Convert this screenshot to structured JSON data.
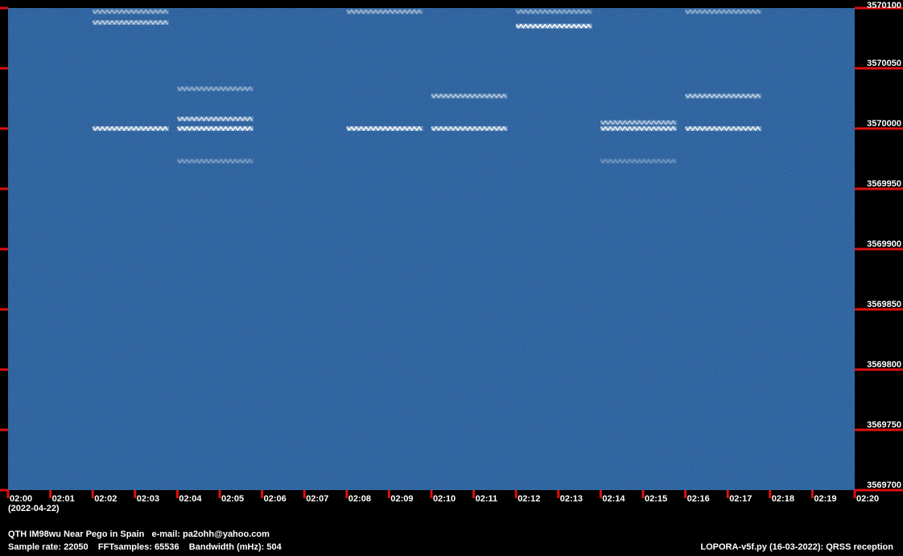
{
  "chart_data": {
    "type": "heatmap",
    "subtype": "spectrogram-waterfall",
    "x_axis": {
      "ticks": [
        "02:00",
        "02:01",
        "02:02",
        "02:03",
        "02:04",
        "02:05",
        "02:06",
        "02:07",
        "02:08",
        "02:09",
        "02:10",
        "02:11",
        "02:12",
        "02:13",
        "02:14",
        "02:15",
        "02:16",
        "02:17",
        "02:18",
        "02:19",
        "02:20"
      ],
      "range_minutes": [
        0,
        20
      ],
      "date_label": "(2022-04-22)"
    },
    "y_axis": {
      "ticks": [
        "3570100",
        "3570050",
        "3570000",
        "3569950",
        "3569900",
        "3569850",
        "3569800",
        "3569750",
        "3569700"
      ],
      "range": [
        3569700,
        3570100
      ],
      "position": "right"
    },
    "colors": {
      "background": "#1d4e91",
      "signal": "#ffffff",
      "tick": "#e01010"
    },
    "signals": [
      {
        "freq": 3570000,
        "start_min": 2.0,
        "end_min": 3.8,
        "intensity": 0.9
      },
      {
        "freq": 3570000,
        "start_min": 4.0,
        "end_min": 5.8,
        "intensity": 0.95
      },
      {
        "freq": 3570000,
        "start_min": 8.0,
        "end_min": 9.8,
        "intensity": 0.95
      },
      {
        "freq": 3570000,
        "start_min": 10.0,
        "end_min": 11.8,
        "intensity": 0.85
      },
      {
        "freq": 3570000,
        "start_min": 14.0,
        "end_min": 15.8,
        "intensity": 0.85
      },
      {
        "freq": 3570000,
        "start_min": 16.0,
        "end_min": 17.8,
        "intensity": 0.85
      },
      {
        "freq": 3570085,
        "start_min": 12.0,
        "end_min": 13.8,
        "intensity": 0.95
      },
      {
        "freq": 3570088,
        "start_min": 2.0,
        "end_min": 3.8,
        "intensity": 0.6
      },
      {
        "freq": 3570008,
        "start_min": 4.0,
        "end_min": 5.8,
        "intensity": 0.7
      },
      {
        "freq": 3570005,
        "start_min": 14.0,
        "end_min": 15.8,
        "intensity": 0.55
      },
      {
        "freq": 3570027,
        "start_min": 10.0,
        "end_min": 11.8,
        "intensity": 0.55
      },
      {
        "freq": 3570027,
        "start_min": 16.0,
        "end_min": 17.8,
        "intensity": 0.6
      },
      {
        "freq": 3570033,
        "start_min": 4.0,
        "end_min": 5.8,
        "intensity": 0.4
      },
      {
        "freq": 3570097,
        "start_min": 2.0,
        "end_min": 3.8,
        "intensity": 0.45
      },
      {
        "freq": 3570097,
        "start_min": 8.0,
        "end_min": 9.8,
        "intensity": 0.45
      },
      {
        "freq": 3570097,
        "start_min": 12.0,
        "end_min": 13.8,
        "intensity": 0.4
      },
      {
        "freq": 3570097,
        "start_min": 16.0,
        "end_min": 17.8,
        "intensity": 0.4
      },
      {
        "freq": 3569973,
        "start_min": 4.0,
        "end_min": 5.8,
        "intensity": 0.3
      },
      {
        "freq": 3569973,
        "start_min": 14.0,
        "end_min": 15.8,
        "intensity": 0.25
      }
    ]
  },
  "footer": {
    "station": "QTH IM98wu Near Pego in Spain   e-mail: pa2ohh@yahoo.com",
    "params": "Sample rate: 22050    FFTsamples: 65536    Bandwidth (mHz): 504",
    "software": "LOPORA-v5f.py (16-03-2022): QRSS reception"
  }
}
